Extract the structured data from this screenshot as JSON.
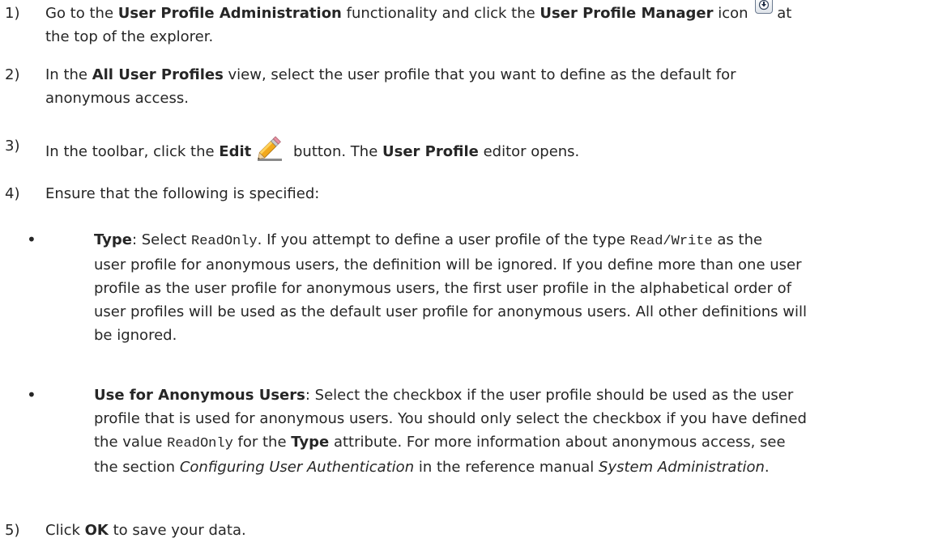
{
  "steps": [
    {
      "num": "1)",
      "a": "Go to the ",
      "b1": "User Profile Administration",
      "c": " functionality and click the ",
      "b2": "User Profile Manager",
      "d": " icon",
      "e": " at",
      "f": "the top of the explorer.",
      "icon": "user-profile-manager-icon"
    },
    {
      "num": "2)",
      "a": "In the ",
      "b1": "All User Profiles",
      "c": " view, select the user profile that you want to define as the default for",
      "d": "anonymous access."
    },
    {
      "num": "3)",
      "a": "In the toolbar, click the ",
      "b1": "Edit",
      "c": " button. The ",
      "b2": "User Profile",
      "d": " editor opens.",
      "icon": "pencil-icon"
    },
    {
      "num": "4)",
      "a": "Ensure that the following is specified:"
    },
    {
      "num": "5)",
      "a": "Click ",
      "b1": "OK",
      "c": " to save your data."
    }
  ],
  "bullets": [
    {
      "label": "Type",
      "l1a": ": Select ",
      "code1": "ReadOnly",
      "l1b": ". If you attempt to define a user profile of the type ",
      "code2": "Read/Write",
      "l1c": " as the",
      "l2": "user profile for anonymous users, the definition will be ignored. If you define more than one user",
      "l3": "profile as the user profile for anonymous users, the first user profile in the alphabetical order of",
      "l4": "user profiles will be used as the default user profile for anonymous users. All other definitions will",
      "l5": "be ignored."
    },
    {
      "label": "Use for Anonymous Users",
      "l1a": ": Select the checkbox if the user profile should be used as the user",
      "l2": "profile that is used for anonymous users. You should only select the checkbox if you have defined",
      "l3a": "the value ",
      "code1": "ReadOnly",
      "l3b": " for the ",
      "type_label": "Type",
      "l3c": " attribute. For more information about anonymous access, see",
      "l4a": "the section ",
      "ital1": "Configuring User Authentication",
      "l4b": " in the reference manual ",
      "ital2": "System Administration",
      "l4c": "."
    }
  ],
  "bullet_glyph": "•"
}
